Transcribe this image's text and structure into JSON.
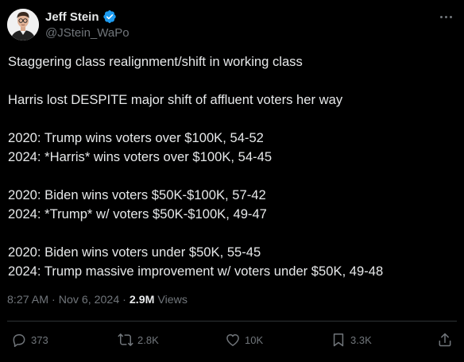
{
  "author": {
    "display_name": "Jeff Stein",
    "handle": "@JStein_WaPo"
  },
  "colors": {
    "background": "#000000",
    "text": "#e7e9ea",
    "secondary": "#71767b",
    "verified": "#1d9bf0"
  },
  "post": {
    "lines": [
      "Staggering class realignment/shift in working class",
      "",
      "Harris lost DESPITE major shift of affluent voters her way",
      "",
      "2020: Trump wins voters over $100K, 54-52",
      "2024: *Harris* wins voters over $100K, 54-45",
      "",
      "2020: Biden wins voters $50K-$100K, 57-42",
      "2024: *Trump* w/ voters $50K-$100K, 49-47",
      "",
      "2020: Biden wins voters under $50K, 55-45",
      "2024: Trump massive improvement w/ voters under $50K, 49-48"
    ]
  },
  "meta": {
    "time": "8:27 AM",
    "separator": "·",
    "date": "Nov 6, 2024",
    "views_count": "2.9M",
    "views_label": "Views"
  },
  "actions": {
    "reply_count": "373",
    "repost_count": "2.8K",
    "like_count": "10K",
    "bookmark_count": "3.3K"
  },
  "icons": [
    "verified-badge-icon",
    "more-icon",
    "reply-icon",
    "repost-icon",
    "like-icon",
    "bookmark-icon",
    "share-icon"
  ]
}
